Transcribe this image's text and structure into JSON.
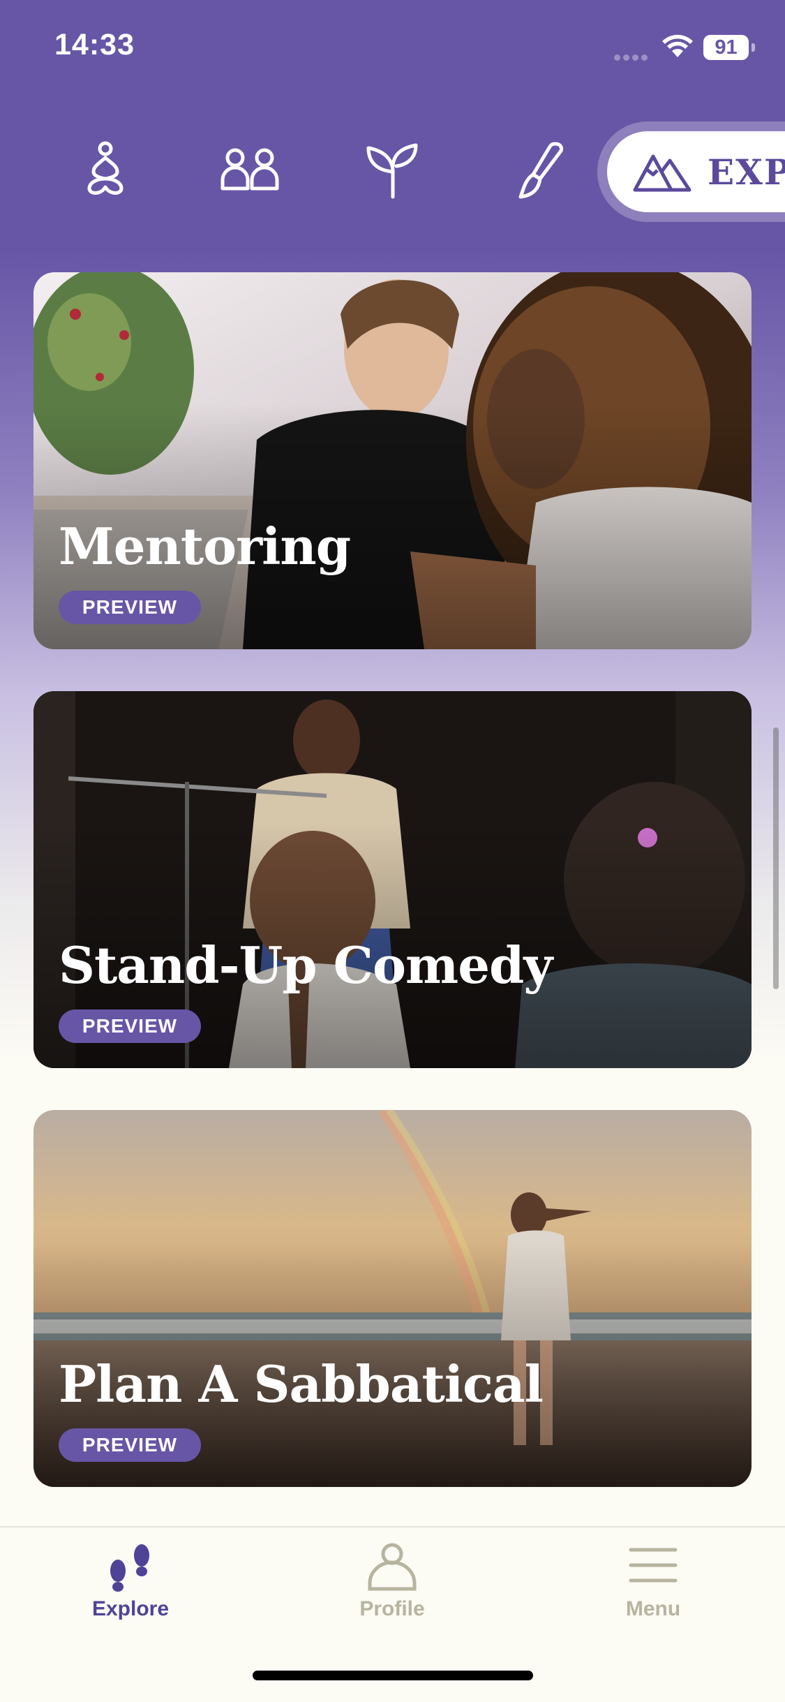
{
  "status_bar": {
    "time": "14:33",
    "battery": "91"
  },
  "categories": [
    {
      "name": "meditation-icon"
    },
    {
      "name": "people-icon"
    },
    {
      "name": "sprout-icon"
    },
    {
      "name": "paintbrush-icon"
    },
    {
      "name": "mountains-icon",
      "label": "EXPA",
      "selected": true
    }
  ],
  "cards": [
    {
      "title": "Mentoring",
      "badge": "PREVIEW"
    },
    {
      "title": "Stand-Up Comedy",
      "badge": "PREVIEW"
    },
    {
      "title": "Plan A Sabbatical",
      "badge": "PREVIEW"
    }
  ],
  "tab_bar": {
    "tabs": [
      {
        "label": "Explore",
        "icon": "footprints-icon",
        "active": true
      },
      {
        "label": "Profile",
        "icon": "person-icon",
        "active": false
      },
      {
        "label": "Menu",
        "icon": "hamburger-menu-icon",
        "active": false
      }
    ]
  },
  "colors": {
    "brand_purple": "#6756a6",
    "cream": "#fcfbf4",
    "inactive_tab": "#b7b49f"
  }
}
